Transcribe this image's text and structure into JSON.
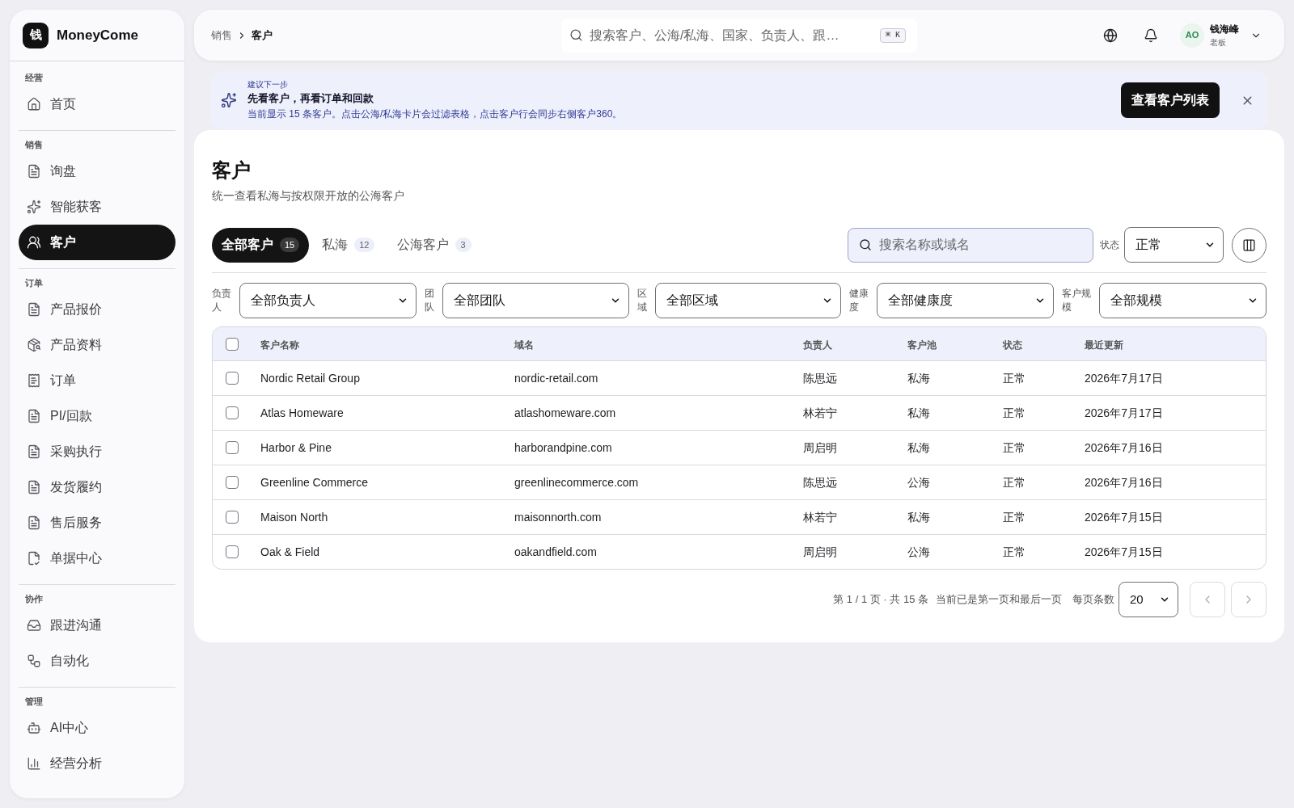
{
  "sidebar": {
    "brand": {
      "logo_char": "钱",
      "name": "MoneyCome"
    },
    "sections": [
      {
        "label": "经营",
        "items": [
          {
            "label": "首页",
            "selected": false
          }
        ]
      },
      {
        "label": "销售",
        "items": [
          {
            "label": "询盘",
            "selected": false
          },
          {
            "label": "智能获客",
            "selected": false
          },
          {
            "label": "客户",
            "selected": true
          }
        ]
      },
      {
        "label": "订单",
        "items": [
          {
            "label": "产品报价",
            "selected": false
          },
          {
            "label": "产品资料",
            "selected": false
          },
          {
            "label": "订单",
            "selected": false
          },
          {
            "label": "PI/回款",
            "selected": false
          },
          {
            "label": "采购执行",
            "selected": false
          },
          {
            "label": "发货履约",
            "selected": false
          },
          {
            "label": "售后服务",
            "selected": false
          },
          {
            "label": "单据中心",
            "selected": false
          }
        ]
      },
      {
        "label": "协作",
        "items": [
          {
            "label": "跟进沟通",
            "selected": false
          },
          {
            "label": "自动化",
            "selected": false
          }
        ]
      },
      {
        "label": "管理",
        "items": [
          {
            "label": "AI中心",
            "selected": false
          },
          {
            "label": "经营分析",
            "selected": false
          }
        ]
      }
    ]
  },
  "top_bar": {
    "breadcrumb": [
      "销售",
      "客户"
    ],
    "search": {
      "placeholder": "搜索客户、公海/私海、国家、负责人、跟…",
      "shortcut": "⌘ K"
    },
    "user": {
      "initials": "AO",
      "name": "钱海峰",
      "role": "老板"
    }
  },
  "banner": {
    "eyebrow": "建议下一步",
    "title": "先看客户，再看订单和回款",
    "description": "当前显示 15 条客户。点击公海/私海卡片会过滤表格，点击客户行会同步右侧客户360。",
    "action": "查看客户列表"
  },
  "page": {
    "title": "客户",
    "subtitle": "统一查看私海与按权限开放的公海客户"
  },
  "tabs": [
    {
      "label": "全部客户",
      "count": "15",
      "selected": true
    },
    {
      "label": "私海",
      "count": "12",
      "selected": false
    },
    {
      "label": "公海客户",
      "count": "3",
      "selected": false
    }
  ],
  "search": {
    "placeholder": "搜索名称或域名"
  },
  "status_filter": {
    "label": "状态",
    "value": "正常"
  },
  "filters": [
    {
      "label": "负责人",
      "value": "全部负责人"
    },
    {
      "label": "团队",
      "value": "全部团队"
    },
    {
      "label": "区域",
      "value": "全部区域"
    },
    {
      "label": "健康度",
      "value": "全部健康度"
    },
    {
      "label": "客户规模",
      "value": "全部规模"
    }
  ],
  "table": {
    "select_all_checked": false,
    "columns": [
      "客户名称",
      "域名",
      "负责人",
      "客户池",
      "状态",
      "最近更新"
    ],
    "rows": [
      {
        "checked": false,
        "cells": [
          "Nordic Retail Group",
          "nordic-retail.com",
          "陈思远",
          "私海",
          "正常",
          "2026年7月17日"
        ]
      },
      {
        "checked": false,
        "cells": [
          "Atlas Homeware",
          "atlashomeware.com",
          "林若宁",
          "私海",
          "正常",
          "2026年7月17日"
        ]
      },
      {
        "checked": false,
        "cells": [
          "Harbor & Pine",
          "harborandpine.com",
          "周启明",
          "私海",
          "正常",
          "2026年7月16日"
        ]
      },
      {
        "checked": false,
        "cells": [
          "Greenline Commerce",
          "greenlinecommerce.com",
          "陈思远",
          "公海",
          "正常",
          "2026年7月16日"
        ]
      },
      {
        "checked": false,
        "cells": [
          "Maison North",
          "maisonnorth.com",
          "林若宁",
          "私海",
          "正常",
          "2026年7月15日"
        ]
      },
      {
        "checked": false,
        "cells": [
          "Oak & Field",
          "oakandfield.com",
          "周启明",
          "公海",
          "正常",
          "2026年7月15日"
        ]
      }
    ]
  },
  "pagination": {
    "summary": "第 1 / 1 页 · 共 15 条",
    "note": "当前已是第一页和最后一页",
    "page_size_label": "每页条数",
    "page_size": "20",
    "prev_disabled": true,
    "next_disabled": true
  }
}
